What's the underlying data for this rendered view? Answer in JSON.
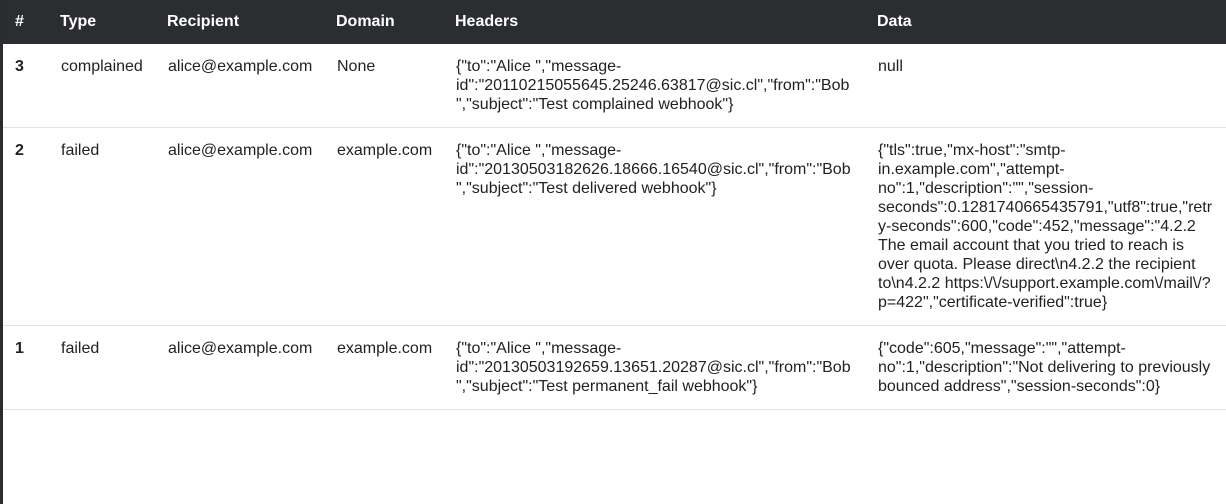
{
  "table": {
    "columns": [
      "#",
      "Type",
      "Recipient",
      "Domain",
      "Headers",
      "Data"
    ],
    "rows": [
      {
        "id": "3",
        "type": "complained",
        "recipient": "alice@example.com",
        "domain": "None",
        "headers": "{\"to\":\"Alice \",\"message-id\":\"20110215055645.25246.63817@sic.cl\",\"from\":\"Bob \",\"subject\":\"Test complained webhook\"}",
        "data": "null"
      },
      {
        "id": "2",
        "type": "failed",
        "recipient": "alice@example.com",
        "domain": "example.com",
        "headers": "{\"to\":\"Alice \",\"message-id\":\"20130503182626.18666.16540@sic.cl\",\"from\":\"Bob \",\"subject\":\"Test delivered webhook\"}",
        "data": "{\"tls\":true,\"mx-host\":\"smtp-in.example.com\",\"attempt-no\":1,\"description\":\"\",\"session-seconds\":0.1281740665435791,\"utf8\":true,\"retry-seconds\":600,\"code\":452,\"message\":\"4.2.2 The email account that you tried to reach is over quota. Please direct\\n4.2.2 the recipient to\\n4.2.2 https:\\/\\/support.example.com\\/mail\\/?p=422\",\"certificate-verified\":true}"
      },
      {
        "id": "1",
        "type": "failed",
        "recipient": "alice@example.com",
        "domain": "example.com",
        "headers": "{\"to\":\"Alice \",\"message-id\":\"20130503192659.13651.20287@sic.cl\",\"from\":\"Bob \",\"subject\":\"Test permanent_fail webhook\"}",
        "data": "{\"code\":605,\"message\":\"\",\"attempt-no\":1,\"description\":\"Not delivering to previously bounced address\",\"session-seconds\":0}"
      }
    ]
  }
}
